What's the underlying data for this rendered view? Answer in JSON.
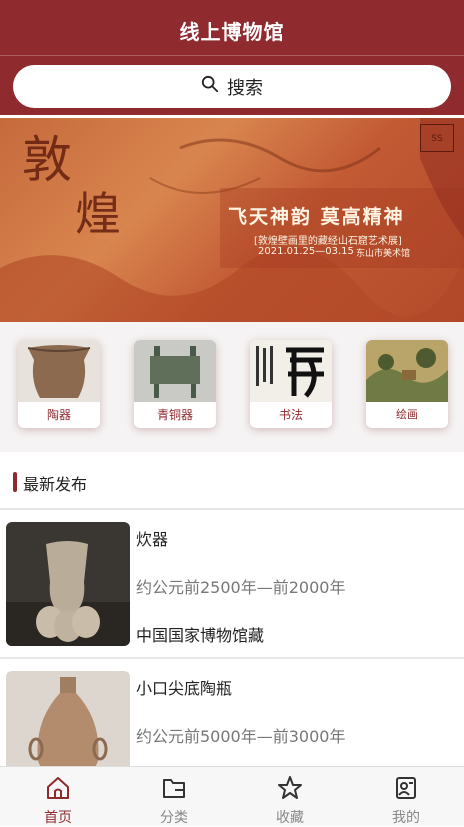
{
  "header": {
    "title": "线上博物馆"
  },
  "search": {
    "label": "搜索"
  },
  "banner": {
    "title_big_1": "敦",
    "title_big_2": "煌",
    "headline": "飞天神韵  莫高精神",
    "subline": "[敦煌壁画里的藏经山石窟艺术展]",
    "dates": "2021.01.25—03.15",
    "venue": "东山市美术馆",
    "slides": 3,
    "active_slide": 1
  },
  "categories": [
    {
      "label": "陶器"
    },
    {
      "label": "青铜器"
    },
    {
      "label": "书法"
    },
    {
      "label": "绘画"
    }
  ],
  "section": {
    "title": "最新发布"
  },
  "items": [
    {
      "name": "炊器",
      "era": "约公元前2500年—前2000年",
      "collection": "中国国家博物馆藏"
    },
    {
      "name": "小口尖底陶瓶",
      "era": "约公元前5000年—前3000年",
      "collection": ""
    }
  ],
  "tabbar": [
    {
      "label": "首页",
      "active": true
    },
    {
      "label": "分类",
      "active": false
    },
    {
      "label": "收藏",
      "active": false
    },
    {
      "label": "我的",
      "active": false
    }
  ],
  "colors": {
    "brand": "#8f2a2e",
    "accent_text": "#8f2a2e",
    "muted": "#888888"
  }
}
